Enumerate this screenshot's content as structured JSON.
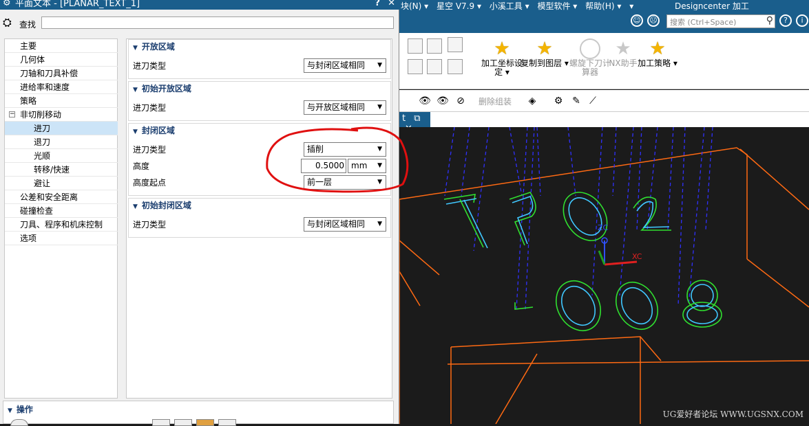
{
  "dialog": {
    "title": "平面文本 - [PLANAR_TEXT_1]",
    "help_label": "?",
    "close_label": "✕",
    "find_label": "查找",
    "find_value": ""
  },
  "tree": {
    "items": [
      {
        "label": "主要",
        "level": 0
      },
      {
        "label": "几何体",
        "level": 0
      },
      {
        "label": "刀轴和刀具补偿",
        "level": 0
      },
      {
        "label": "进给率和速度",
        "level": 0
      },
      {
        "label": "策略",
        "level": 0
      },
      {
        "label": "非切削移动",
        "level": 0,
        "expander": "−"
      },
      {
        "label": "进刀",
        "level": 1,
        "selected": true
      },
      {
        "label": "退刀",
        "level": 1
      },
      {
        "label": "光顺",
        "level": 1
      },
      {
        "label": "转移/快速",
        "level": 1
      },
      {
        "label": "避让",
        "level": 1
      },
      {
        "label": "公差和安全距离",
        "level": 0
      },
      {
        "label": "碰撞检查",
        "level": 0
      },
      {
        "label": "刀具、程序和机床控制",
        "level": 0
      },
      {
        "label": "选项",
        "level": 0
      }
    ]
  },
  "panel": {
    "open_area": {
      "title": "开放区域",
      "field_label": "进刀类型",
      "value": "与封闭区域相同"
    },
    "initial_open_area": {
      "title": "初始开放区域",
      "field_label": "进刀类型",
      "value": "与开放区域相同"
    },
    "closed_area": {
      "title": "封闭区域",
      "type_label": "进刀类型",
      "type_value": "插削",
      "height_label": "高度",
      "height_value": "0.5000",
      "height_unit": "mm",
      "start_label": "高度起点",
      "start_value": "前一层"
    },
    "initial_closed_area": {
      "title": "初始封闭区域",
      "field_label": "进刀类型",
      "value": "与封闭区域相同"
    }
  },
  "operations": {
    "title": "操作"
  },
  "app": {
    "menu": [
      "块(N) ▾",
      "星空 V7.9 ▾",
      "小溪工具 ▾",
      "模型软件 ▾",
      "帮助(H) ▾",
      "▾"
    ],
    "window_title": "Designcenter 加工",
    "search_placeholder": "搜索 (Ctrl+Space)",
    "ribbon_buttons": [
      {
        "label": "加工坐标设定 ▾",
        "icon": "star-icon"
      },
      {
        "label": "复制到图层 ▾",
        "icon": "star-icon"
      },
      {
        "label": "螺旋下刀计算器",
        "icon": "spiral-icon",
        "disabled": true
      },
      {
        "label": "NX助手",
        "icon": "star-icon",
        "disabled": true
      },
      {
        "label": "加工策略 ▾",
        "icon": "star-icon"
      }
    ],
    "toolbar_label": "删除组装",
    "tab_label": "t",
    "tab_close": "✕",
    "axis_labels": {
      "zc": "ZC",
      "xc": "XC"
    },
    "watermark": "UG爱好者论坛 WWW.UGSNX.COM"
  },
  "colors": {
    "title_bar": "#1a5e8c",
    "wire_orange": "#ff6a13",
    "path_blue": "#3030ff",
    "text_green": "#30e030",
    "text_cyan": "#40c8ff",
    "annotation_red": "#e01010"
  }
}
